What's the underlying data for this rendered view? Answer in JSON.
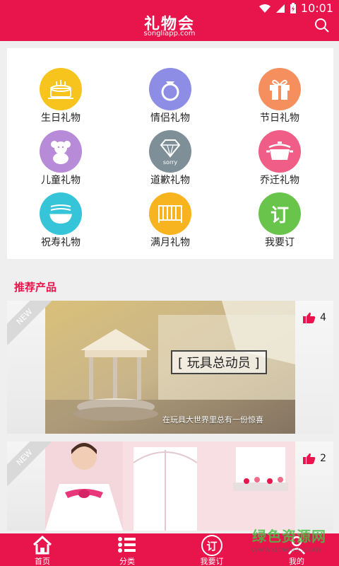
{
  "status_bar": {
    "time": "10:01"
  },
  "header": {
    "title": "礼物会",
    "subtitle": "songliapp.com"
  },
  "categories": [
    {
      "label": "生日礼物",
      "icon": "cake-icon",
      "color": "#f7c41e"
    },
    {
      "label": "情侣礼物",
      "icon": "ring-icon",
      "color": "#8d8de6"
    },
    {
      "label": "节日礼物",
      "icon": "gift-icon",
      "color": "#f58f5e"
    },
    {
      "label": "儿童礼物",
      "icon": "teddy-bear-icon",
      "color": "#b88bd8"
    },
    {
      "label": "道歉礼物",
      "icon": "diamond-sorry-icon",
      "color": "#7e8f98"
    },
    {
      "label": "乔迁礼物",
      "icon": "pot-icon",
      "color": "#f05d86"
    },
    {
      "label": "祝寿礼物",
      "icon": "bowl-icon",
      "color": "#36c4d9"
    },
    {
      "label": "满月礼物",
      "icon": "crib-icon",
      "color": "#f7b41f"
    },
    {
      "label": "我要订",
      "icon": "order-icon",
      "color": "#68c44a",
      "badge": "订"
    }
  ],
  "section": {
    "title": "推荐产品"
  },
  "products": [
    {
      "badge": "NEW",
      "likes": "4",
      "overlay_title": "[ 玩具总动员 ]",
      "overlay_sub": "在玩具大世界里总有一份惊喜"
    },
    {
      "badge": "NEW",
      "likes": "2"
    }
  ],
  "bottom_nav": [
    {
      "label": "首页",
      "icon": "home-icon"
    },
    {
      "label": "分类",
      "icon": "list-icon"
    },
    {
      "label": "我要订",
      "icon": "order-icon",
      "badge": "订"
    },
    {
      "label": "我的",
      "icon": "profile-icon"
    }
  ],
  "watermark": {
    "text": "绿色资源网",
    "sub": "www.downcc.com"
  },
  "colors": {
    "brand": "#e8154c"
  }
}
